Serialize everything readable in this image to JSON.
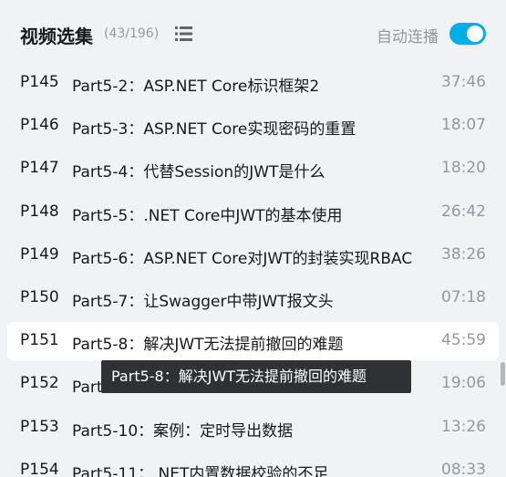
{
  "header": {
    "title": "视频选集",
    "count": "(43/196)",
    "list_icon": "list-icon",
    "autoplay_label": "自动连播",
    "autoplay_on": true,
    "accent_color": "#00aeec"
  },
  "episodes": [
    {
      "p": "P145",
      "title": "Part5-2：ASP.NET Core标识框架2",
      "duration": "37:46"
    },
    {
      "p": "P146",
      "title": "Part5-3：ASP.NET Core实现密码的重置",
      "duration": "18:07"
    },
    {
      "p": "P147",
      "title": "Part5-4：代替Session的JWT是什么",
      "duration": "18:20"
    },
    {
      "p": "P148",
      "title": "Part5-5：.NET Core中JWT的基本使用",
      "duration": "26:42"
    },
    {
      "p": "P149",
      "title": "Part5-6：ASP.NET Core对JWT的封装实现RBAC",
      "duration": "38:26"
    },
    {
      "p": "P150",
      "title": "Part5-7：让Swagger中带JWT报文头",
      "duration": "07:18"
    },
    {
      "p": "P151",
      "title": "Part5-8：解决JWT无法提前撤回的难题",
      "duration": "45:59"
    },
    {
      "p": "P152",
      "title": "Part5-9：",
      "duration": "19:06"
    },
    {
      "p": "P153",
      "title": "Part5-10：案例：定时导出数据",
      "duration": "13:26"
    },
    {
      "p": "P154",
      "title": "Part5-11：.NET内置数据校验的不足",
      "duration": "08:33"
    }
  ],
  "active_index": 6,
  "tooltip": "Part5-8：解决JWT无法提前撤回的难题"
}
